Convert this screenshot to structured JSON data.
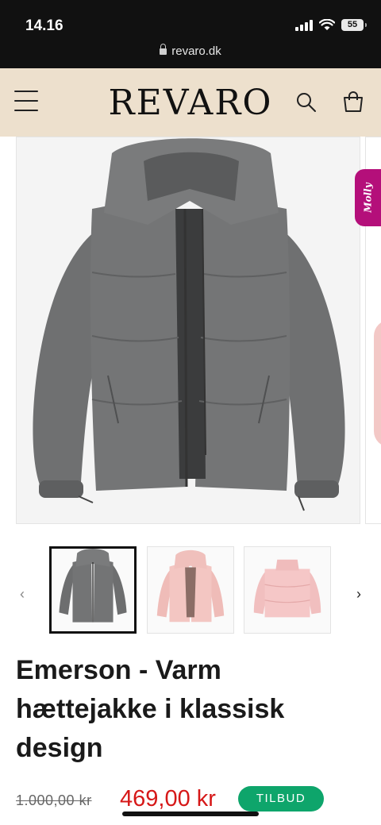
{
  "status_bar": {
    "time": "14.16",
    "battery": "55",
    "url": "revaro.dk"
  },
  "header": {
    "logo": "REVARO",
    "icons": [
      "menu-icon",
      "search-icon",
      "cart-icon"
    ]
  },
  "chat_widget": {
    "label": "Molly",
    "color": "#b40f7a"
  },
  "gallery": {
    "thumbnails": [
      {
        "name": "grey-jacket-hooded",
        "color": "#6d6e6f",
        "selected": true
      },
      {
        "name": "pink-jacket-hooded",
        "color": "#f0c0bd",
        "selected": false
      },
      {
        "name": "pink-jacket-collar",
        "color": "#f4c3c3",
        "selected": false
      }
    ],
    "prev_icon": "chevron-left-icon",
    "next_icon": "chevron-right-icon"
  },
  "product": {
    "title": "Emerson - Varm hættejakke i klassisk design",
    "old_price": "1.000,00 kr",
    "price": "469,00 kr",
    "badge": "TILBUD"
  },
  "colors": {
    "header_bg": "#ede0cd",
    "price_red": "#d61818",
    "badge_green": "#0ea56b"
  }
}
